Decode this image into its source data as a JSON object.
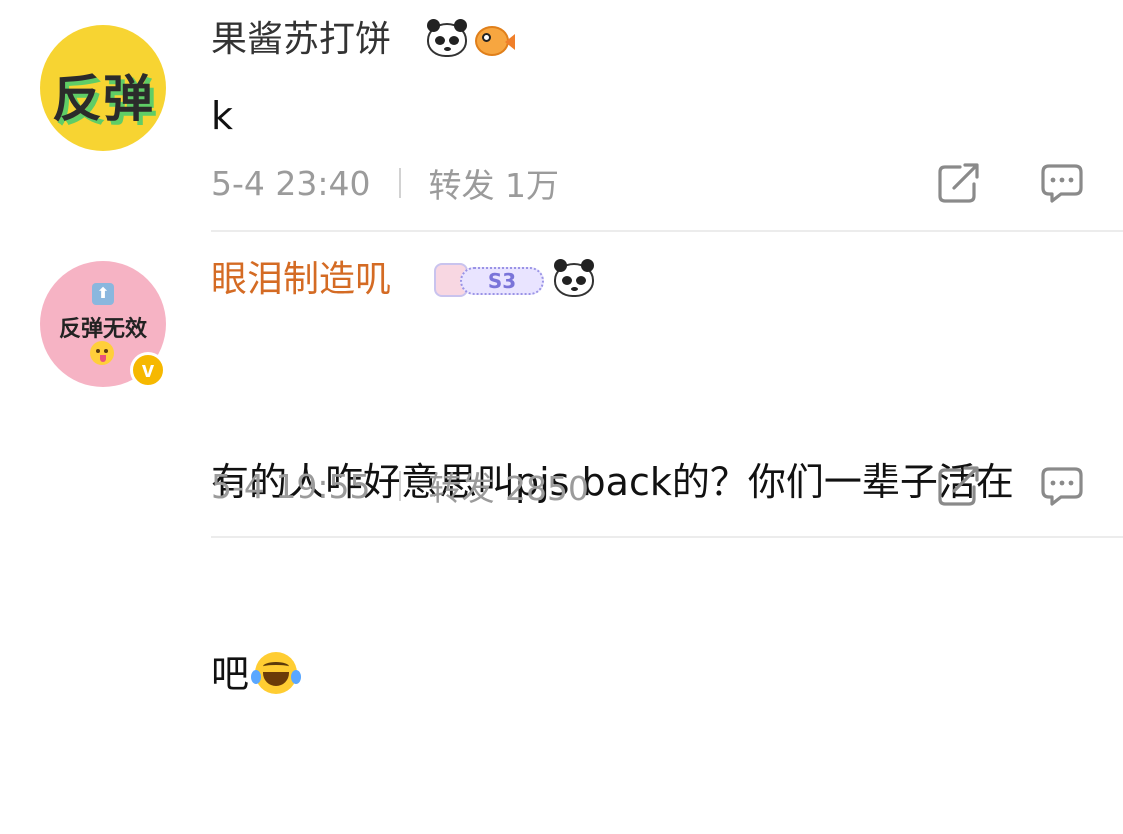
{
  "posts": [
    {
      "avatar_text": "反弹",
      "username": "果酱苏打饼",
      "badges": [
        "panda-icon",
        "pufferfish-icon"
      ],
      "content": "k",
      "date": "5-4 23:40",
      "repost_label": "转发",
      "repost_count": "1万"
    },
    {
      "avatar_text": "反弹无效",
      "avatar_arrow": "⬆",
      "verified_badge": "v",
      "username": "眼泪制造叽",
      "badges": [
        "s3-badge",
        "panda-icon"
      ],
      "badge_text": "S3",
      "content_line1": "有的人咋好意思叫pjs back的？你们一辈子活在",
      "content_line2": "吧",
      "date": "5-4 19:55",
      "repost_label": "转发",
      "repost_count": "2850"
    }
  ],
  "colors": {
    "username_default": "#333333",
    "username_vip": "#d46b24",
    "meta_text": "#9b9b9b",
    "divider": "#ececec"
  }
}
